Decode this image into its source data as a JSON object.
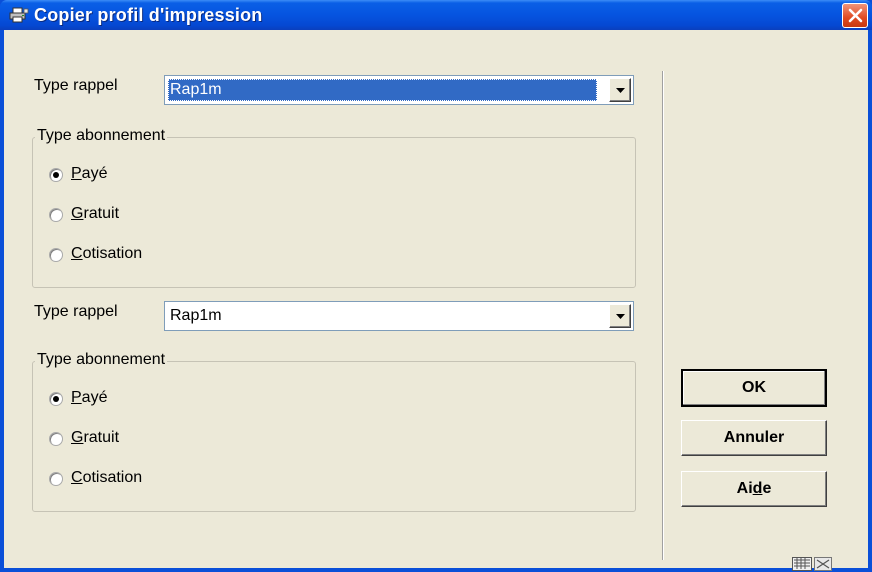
{
  "window": {
    "title": "Copier profil d'impression"
  },
  "section1": {
    "type_rappel_label": "Type rappel",
    "type_rappel_value": "Rap1m",
    "group_title": "Type abonnement",
    "options": [
      {
        "prefix": "",
        "accel": "P",
        "rest": "ayé",
        "checked": true
      },
      {
        "prefix": "",
        "accel": "G",
        "rest": "ratuit",
        "checked": false
      },
      {
        "prefix": "",
        "accel": "C",
        "rest": "otisation",
        "checked": false
      }
    ]
  },
  "section2": {
    "type_rappel_label": "Type rappel",
    "type_rappel_value": "Rap1m",
    "group_title": "Type abonnement",
    "options": [
      {
        "prefix": "",
        "accel": "P",
        "rest": "ayé",
        "checked": true
      },
      {
        "prefix": "",
        "accel": "G",
        "rest": "ratuit",
        "checked": false
      },
      {
        "prefix": "",
        "accel": "C",
        "rest": "otisation",
        "checked": false
      }
    ]
  },
  "buttons": {
    "ok": "OK",
    "cancel": "Annuler",
    "help_prefix": "Ai",
    "help_accel": "d",
    "help_rest": "e"
  },
  "colors": {
    "titlebar": "#0654e0",
    "dialog_bg": "#ece9d8",
    "selection": "#316ac5",
    "close": "#e04a22"
  },
  "icons": [
    "printer-icon",
    "close-icon",
    "dropdown-arrow-icon",
    "keyboard-icon",
    "resize-icon"
  ]
}
